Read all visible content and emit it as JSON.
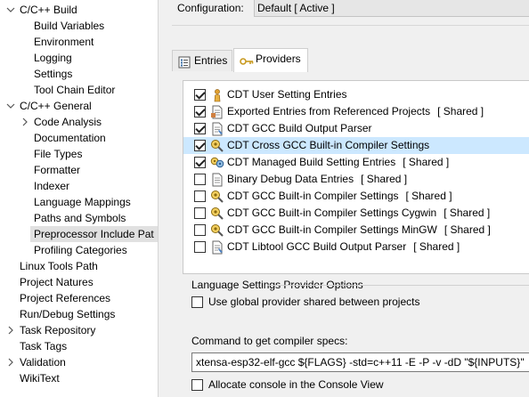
{
  "tree": {
    "items": [
      {
        "label": "C/C++ Build",
        "expander": "v"
      },
      {
        "label": "Build Variables",
        "expander": ""
      },
      {
        "label": "Environment",
        "expander": ""
      },
      {
        "label": "Logging",
        "expander": ""
      },
      {
        "label": "Settings",
        "expander": ""
      },
      {
        "label": "Tool Chain Editor",
        "expander": ""
      },
      {
        "label": "C/C++ General",
        "expander": "v"
      },
      {
        "label": "Code Analysis",
        "expander": ">"
      },
      {
        "label": "Documentation",
        "expander": ""
      },
      {
        "label": "File Types",
        "expander": ""
      },
      {
        "label": "Formatter",
        "expander": ""
      },
      {
        "label": "Indexer",
        "expander": ""
      },
      {
        "label": "Language Mappings",
        "expander": ""
      },
      {
        "label": "Paths and Symbols",
        "expander": ""
      },
      {
        "label": "Preprocessor Include Pat",
        "expander": ""
      },
      {
        "label": "Profiling Categories",
        "expander": ""
      },
      {
        "label": "Linux Tools Path",
        "expander": ""
      },
      {
        "label": "Project Natures",
        "expander": ""
      },
      {
        "label": "Project References",
        "expander": ""
      },
      {
        "label": "Run/Debug Settings",
        "expander": ""
      },
      {
        "label": "Task Repository",
        "expander": ">"
      },
      {
        "label": "Task Tags",
        "expander": ""
      },
      {
        "label": "Validation",
        "expander": ">"
      },
      {
        "label": "WikiText",
        "expander": ""
      }
    ]
  },
  "config": {
    "label": "Configuration:",
    "value": "Default  [ Active ]"
  },
  "tabs": {
    "entries": "Entries",
    "providers": "Providers"
  },
  "providers": [
    {
      "name": "CDT User Setting Entries",
      "tag": "",
      "checked": true,
      "icon": "user-icon"
    },
    {
      "name": "Exported Entries from Referenced Projects",
      "tag": "[ Shared ]",
      "checked": true,
      "icon": "document-icon"
    },
    {
      "name": "CDT GCC Build Output Parser",
      "tag": "",
      "checked": true,
      "icon": "parser-document-icon"
    },
    {
      "name": "CDT Cross GCC Built-in Compiler Settings",
      "tag": "",
      "checked": true,
      "icon": "compiler-icon"
    },
    {
      "name": "CDT Managed Build Setting Entries",
      "tag": "[ Shared ]",
      "checked": true,
      "icon": "managed-build-icon"
    },
    {
      "name": "Binary Debug Data Entries",
      "tag": "[ Shared ]",
      "checked": false,
      "icon": "document-icon"
    },
    {
      "name": "CDT GCC Built-in Compiler Settings",
      "tag": "[ Shared ]",
      "checked": false,
      "icon": "compiler-icon"
    },
    {
      "name": "CDT GCC Built-in Compiler Settings Cygwin",
      "tag": "[ Shared ]",
      "checked": false,
      "icon": "compiler-icon"
    },
    {
      "name": "CDT GCC Built-in Compiler Settings MinGW",
      "tag": "[ Shared ]",
      "checked": false,
      "icon": "compiler-icon"
    },
    {
      "name": "CDT Libtool GCC Build Output Parser",
      "tag": "[ Shared ]",
      "checked": false,
      "icon": "parser-document-icon"
    }
  ],
  "options": {
    "group_title": "Language Settings Provider Options",
    "use_global_label": "Use global provider shared between projects",
    "use_global_checked": false,
    "command_label": "Command to get compiler specs:",
    "command_value": "xtensa-esp32-elf-gcc ${FLAGS} -std=c++11 -E -P -v -dD \"${INPUTS}\"",
    "allocate_console_label": "Allocate console in the Console View",
    "allocate_console_checked": false
  },
  "colors": {
    "selection": "#cce8ff",
    "tree_selection": "#e1e1e1",
    "panel_bg": "#f0f0f0"
  }
}
